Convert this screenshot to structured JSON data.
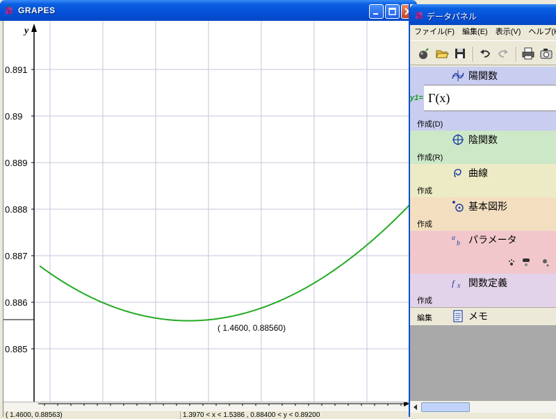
{
  "grapes": {
    "title": "GRAPES",
    "y_axis_label": "y",
    "y_ticks": [
      {
        "value": 0.891,
        "label": "0.891"
      },
      {
        "value": 0.89,
        "label": "0.89"
      },
      {
        "value": 0.889,
        "label": "0.889"
      },
      {
        "value": 0.888,
        "label": "0.888"
      },
      {
        "value": 0.887,
        "label": "0.887"
      },
      {
        "value": 0.886,
        "label": "0.886"
      },
      {
        "value": 0.885,
        "label": "0.885"
      }
    ],
    "x_range": [
      1.397,
      1.5386
    ],
    "y_range": [
      0.884,
      0.892
    ],
    "curve_color": "#22aa22",
    "grid_color": "#c4c4dc",
    "point_label": "( 1.4600, 0.88560)",
    "status": {
      "cursor": "( 1.4600, 0.88563)",
      "range": "1.3970 < x < 1.5386 , 0.88400 < y < 0.89200"
    }
  },
  "panel": {
    "title": "データパネル",
    "menu": [
      "ファイル(F)",
      "編集(E)",
      "表示(V)",
      "ヘルプ(H)"
    ],
    "toolbar": [
      {
        "name": "new-icon"
      },
      {
        "name": "open-folder-icon"
      },
      {
        "name": "save-icon"
      },
      {
        "name": "undo-icon"
      },
      {
        "name": "redo-icon"
      },
      {
        "name": "print-icon"
      },
      {
        "name": "camera-icon"
      }
    ],
    "explicit": {
      "title": "陽関数",
      "func_label": "y1=",
      "expression": "Γ(x)",
      "create": "作成(D)"
    },
    "implicit": {
      "title": "陰関数",
      "create": "作成(R)"
    },
    "curve": {
      "title": "曲線",
      "create": "作成"
    },
    "figure": {
      "title": "基本図形",
      "create": "作成"
    },
    "parameter": {
      "title": "パラメータ"
    },
    "function_def": {
      "title": "関数定義",
      "create": "作成"
    },
    "memo": {
      "edit": "編集",
      "title": "メモ"
    }
  }
}
